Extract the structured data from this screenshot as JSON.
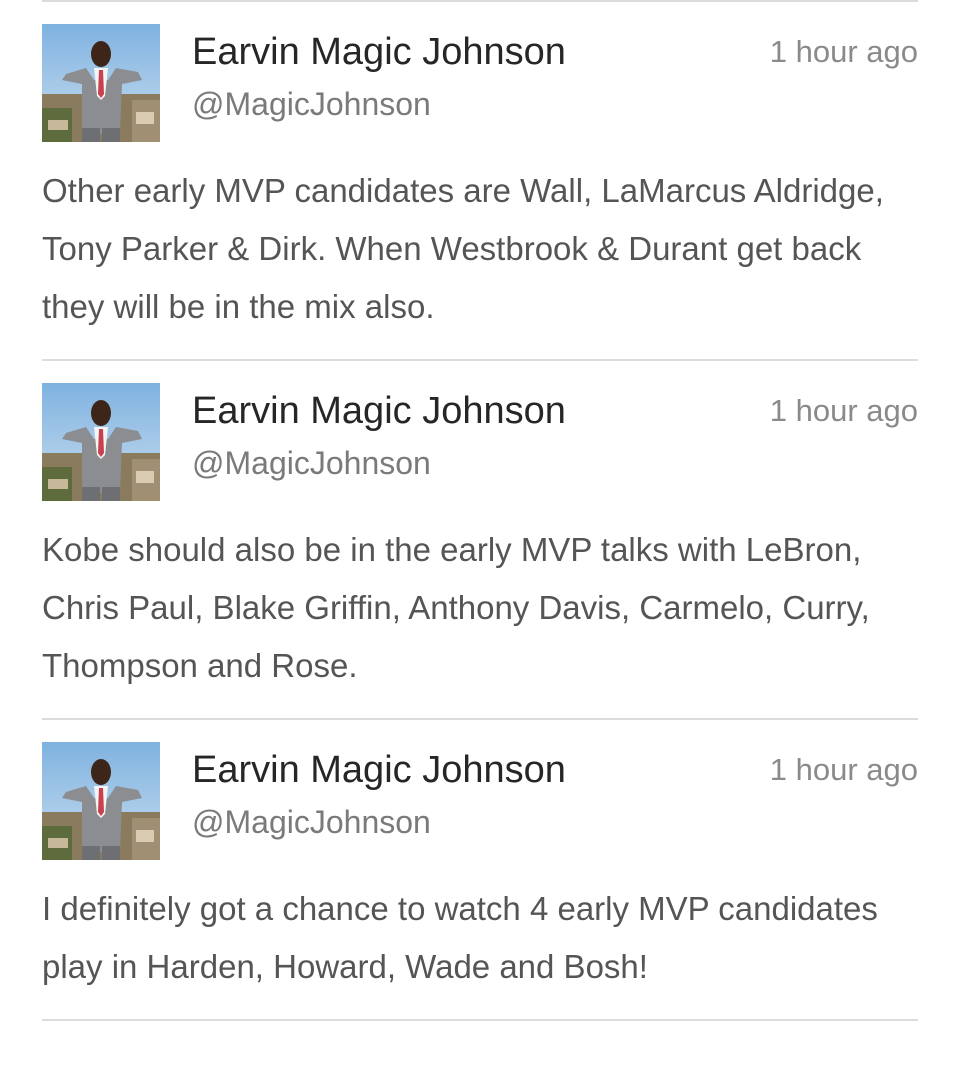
{
  "tweets": [
    {
      "name": "Earvin Magic Johnson",
      "handle": "@MagicJohnson",
      "time": "1 hour ago",
      "text": "Other early MVP candidates are Wall, LaMarcus Aldridge, Tony Parker & Dirk. When Westbrook & Durant get back they will be in the mix also."
    },
    {
      "name": "Earvin Magic Johnson",
      "handle": "@MagicJohnson",
      "time": "1 hour ago",
      "text": "Kobe should also be in the early MVP talks with LeBron, Chris Paul, Blake Griffin, Anthony Davis, Carmelo, Curry, Thompson and Rose."
    },
    {
      "name": "Earvin Magic Johnson",
      "handle": "@MagicJohnson",
      "time": "1 hour ago",
      "text": "I definitely got a chance to watch 4 early MVP candidates play in Harden, Howard, Wade and Bosh!"
    }
  ],
  "colors": {
    "divider": "#dcdcdc",
    "name": "#262626",
    "handle": "#7a7a7a",
    "time": "#8a8a8a",
    "body": "#555555"
  },
  "icons": {
    "avatar": "profile-photo"
  }
}
